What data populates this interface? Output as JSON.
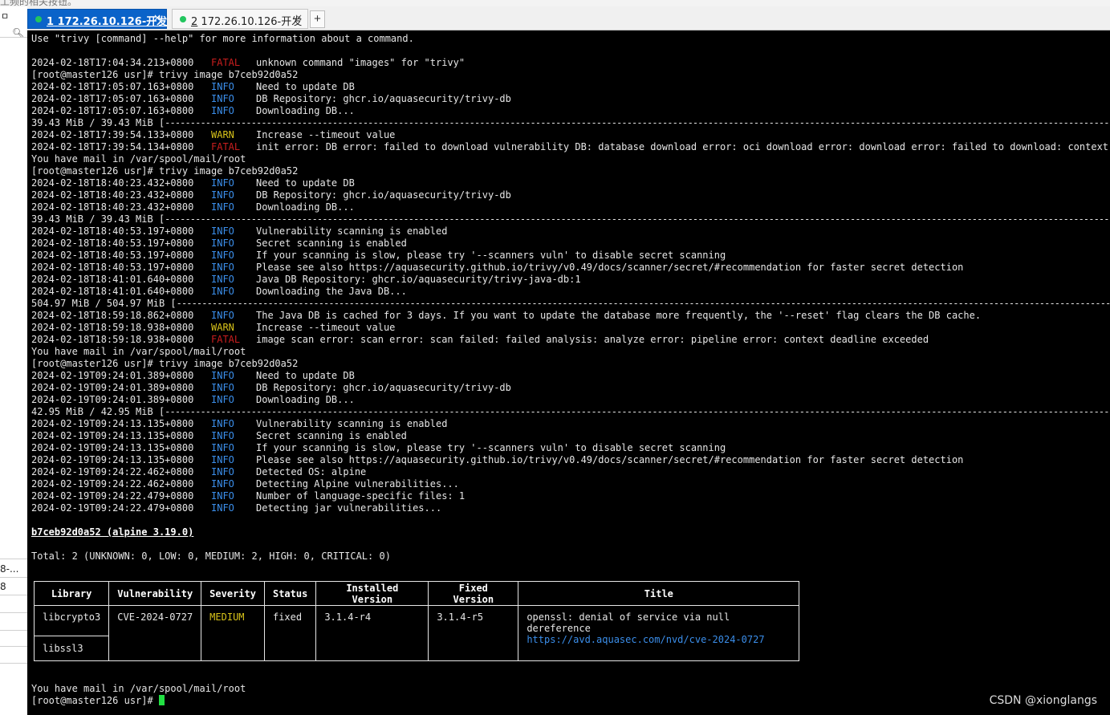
{
  "topstrip_text": "工频的相关按钮。",
  "sidebar": {
    "pin_icon": "pin-icon",
    "search_icon": "search-icon",
    "items": [
      "8-...",
      "8"
    ]
  },
  "tabs": [
    {
      "number": "1",
      "label": "172.26.10.126-开发",
      "active": true,
      "status_color": "#22c55e"
    },
    {
      "number": "2",
      "label": "172.26.10.126-开发",
      "active": false,
      "status_color": "#22c55e"
    }
  ],
  "tab_close_glyph": "×",
  "new_tab_glyph": "+",
  "terminal": {
    "lines": [
      {
        "text": "Use \"trivy [command] --help\" for more information about a command."
      },
      {
        "text": ""
      },
      {
        "ts": "2024-02-18T17:04:34.213+0800",
        "level": "FATAL",
        "msg": "unknown command \"images\" for \"trivy\""
      },
      {
        "text": "[root@master126 usr]# trivy image b7ceb92d0a52"
      },
      {
        "ts": "2024-02-18T17:05:07.163+0800",
        "level": "INFO",
        "msg": "Need to update DB"
      },
      {
        "ts": "2024-02-18T17:05:07.163+0800",
        "level": "INFO",
        "msg": "DB Repository: ghcr.io/aquasecurity/trivy-db"
      },
      {
        "ts": "2024-02-18T17:05:07.163+0800",
        "level": "INFO",
        "msg": "Downloading DB..."
      },
      {
        "text": "39.43 MiB / 39.43 MiB [",
        "dash": true
      },
      {
        "ts": "2024-02-18T17:39:54.133+0800",
        "level": "WARN",
        "msg": "Increase --timeout value"
      },
      {
        "ts": "2024-02-18T17:39:54.134+0800",
        "level": "FATAL",
        "msg": "init error: DB error: failed to download vulnerability DB: database download error: oci download error: download error: failed to download: context dead"
      },
      {
        "text": "You have mail in /var/spool/mail/root"
      },
      {
        "text": "[root@master126 usr]# trivy image b7ceb92d0a52"
      },
      {
        "ts": "2024-02-18T18:40:23.432+0800",
        "level": "INFO",
        "msg": "Need to update DB"
      },
      {
        "ts": "2024-02-18T18:40:23.432+0800",
        "level": "INFO",
        "msg": "DB Repository: ghcr.io/aquasecurity/trivy-db"
      },
      {
        "ts": "2024-02-18T18:40:23.432+0800",
        "level": "INFO",
        "msg": "Downloading DB..."
      },
      {
        "text": "39.43 MiB / 39.43 MiB [",
        "dash": true
      },
      {
        "ts": "2024-02-18T18:40:53.197+0800",
        "level": "INFO",
        "msg": "Vulnerability scanning is enabled"
      },
      {
        "ts": "2024-02-18T18:40:53.197+0800",
        "level": "INFO",
        "msg": "Secret scanning is enabled"
      },
      {
        "ts": "2024-02-18T18:40:53.197+0800",
        "level": "INFO",
        "msg": "If your scanning is slow, please try '--scanners vuln' to disable secret scanning"
      },
      {
        "ts": "2024-02-18T18:40:53.197+0800",
        "level": "INFO",
        "msg": "Please see also https://aquasecurity.github.io/trivy/v0.49/docs/scanner/secret/#recommendation for faster secret detection"
      },
      {
        "ts": "2024-02-18T18:41:01.640+0800",
        "level": "INFO",
        "msg": "Java DB Repository: ghcr.io/aquasecurity/trivy-java-db:1"
      },
      {
        "ts": "2024-02-18T18:41:01.640+0800",
        "level": "INFO",
        "msg": "Downloading the Java DB..."
      },
      {
        "text": "504.97 MiB / 504.97 MiB [",
        "dash": true
      },
      {
        "ts": "2024-02-18T18:59:18.862+0800",
        "level": "INFO",
        "msg": "The Java DB is cached for 3 days. If you want to update the database more frequently, the '--reset' flag clears the DB cache."
      },
      {
        "ts": "2024-02-18T18:59:18.938+0800",
        "level": "WARN",
        "msg": "Increase --timeout value"
      },
      {
        "ts": "2024-02-18T18:59:18.938+0800",
        "level": "FATAL",
        "msg": "image scan error: scan error: scan failed: failed analysis: analyze error: pipeline error: context deadline exceeded"
      },
      {
        "text": "You have mail in /var/spool/mail/root"
      },
      {
        "text": "[root@master126 usr]# trivy image b7ceb92d0a52"
      },
      {
        "ts": "2024-02-19T09:24:01.389+0800",
        "level": "INFO",
        "msg": "Need to update DB"
      },
      {
        "ts": "2024-02-19T09:24:01.389+0800",
        "level": "INFO",
        "msg": "DB Repository: ghcr.io/aquasecurity/trivy-db"
      },
      {
        "ts": "2024-02-19T09:24:01.389+0800",
        "level": "INFO",
        "msg": "Downloading DB..."
      },
      {
        "text": "42.95 MiB / 42.95 MiB [",
        "dash": true
      },
      {
        "ts": "2024-02-19T09:24:13.135+0800",
        "level": "INFO",
        "msg": "Vulnerability scanning is enabled"
      },
      {
        "ts": "2024-02-19T09:24:13.135+0800",
        "level": "INFO",
        "msg": "Secret scanning is enabled"
      },
      {
        "ts": "2024-02-19T09:24:13.135+0800",
        "level": "INFO",
        "msg": "If your scanning is slow, please try '--scanners vuln' to disable secret scanning"
      },
      {
        "ts": "2024-02-19T09:24:13.135+0800",
        "level": "INFO",
        "msg": "Please see also https://aquasecurity.github.io/trivy/v0.49/docs/scanner/secret/#recommendation for faster secret detection"
      },
      {
        "ts": "2024-02-19T09:24:22.462+0800",
        "level": "INFO",
        "msg": "Detected OS: alpine"
      },
      {
        "ts": "2024-02-19T09:24:22.462+0800",
        "level": "INFO",
        "msg": "Detecting Alpine vulnerabilities..."
      },
      {
        "ts": "2024-02-19T09:24:22.479+0800",
        "level": "INFO",
        "msg": "Number of language-specific files: 1"
      },
      {
        "ts": "2024-02-19T09:24:22.479+0800",
        "level": "INFO",
        "msg": "Detecting jar vulnerabilities..."
      }
    ],
    "report_heading": "b7ceb92d0a52 (alpine 3.19.0)",
    "total_line": "Total: 2 (UNKNOWN: 0, LOW: 0, MEDIUM: 2, HIGH: 0, CRITICAL: 0)",
    "table": {
      "headers": [
        "Library",
        "Vulnerability",
        "Severity",
        "Status",
        "Installed Version",
        "Fixed Version",
        "Title"
      ],
      "libraries": [
        "libcrypto3",
        "libssl3"
      ],
      "vulnerability": "CVE-2024-0727",
      "severity": "MEDIUM",
      "status": "fixed",
      "installed_version": "3.1.4-r4",
      "fixed_version": "3.1.4-r5",
      "title": "openssl: denial of service via null dereference",
      "title_link": "https://avd.aquasec.com/nvd/cve-2024-0727"
    },
    "mail_notice": "You have mail in /var/spool/mail/root",
    "prompt": "[root@master126 usr]# "
  },
  "watermark": "CSDN @xionglangs",
  "colors": {
    "terminal_bg": "#000000",
    "info": "#3b8eea",
    "warn": "#d7c21a",
    "fatal": "#c81e1e",
    "cursor": "#22e043",
    "active_tab": "#0a63c9"
  }
}
